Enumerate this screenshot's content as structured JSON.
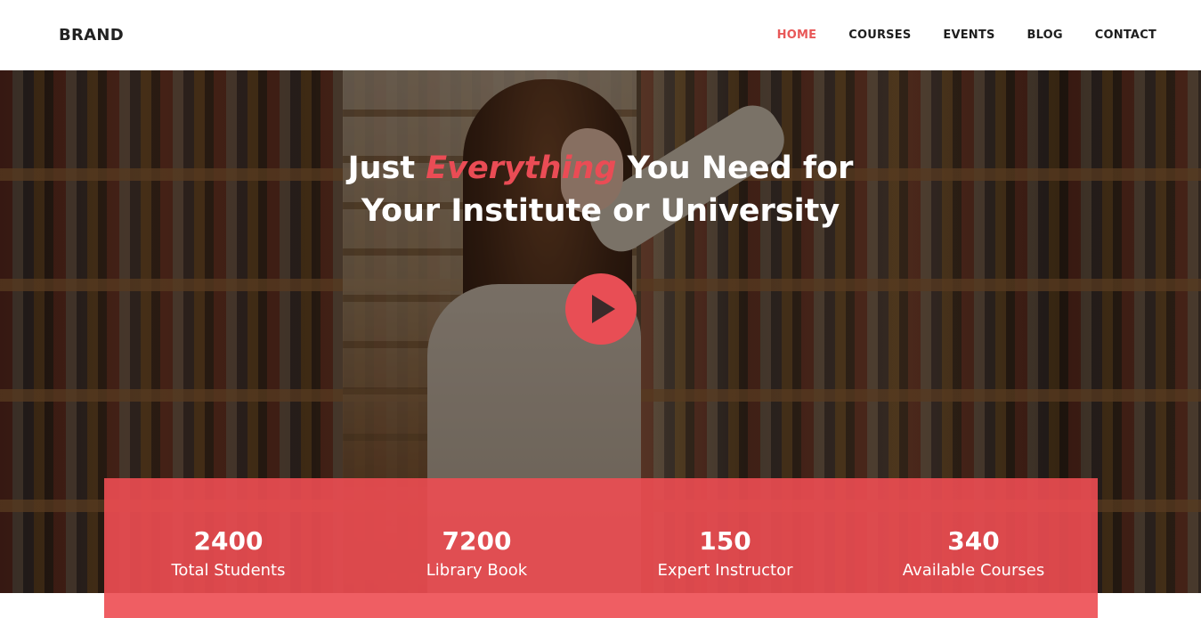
{
  "header": {
    "brand": "BRAND",
    "nav": [
      {
        "label": "HOME",
        "active": true
      },
      {
        "label": "COURSES",
        "active": false
      },
      {
        "label": "EVENTS",
        "active": false
      },
      {
        "label": "BLOG",
        "active": false
      },
      {
        "label": "CONTACT",
        "active": false
      }
    ]
  },
  "hero": {
    "title_part1": "Just ",
    "title_accent": "Everything",
    "title_part2": " You Need for",
    "title_line2": "Your Institute or University",
    "play_icon": "play-icon"
  },
  "stats": [
    {
      "number": "2400",
      "label": "Total Students"
    },
    {
      "number": "7200",
      "label": "Library Book"
    },
    {
      "number": "150",
      "label": "Expert Instructor"
    },
    {
      "number": "340",
      "label": "Available Courses"
    }
  ],
  "colors": {
    "accent": "#e85858",
    "stats_background": "#ed4d52",
    "header_background": "#ffffff",
    "nav_text": "#1e1e1e"
  }
}
